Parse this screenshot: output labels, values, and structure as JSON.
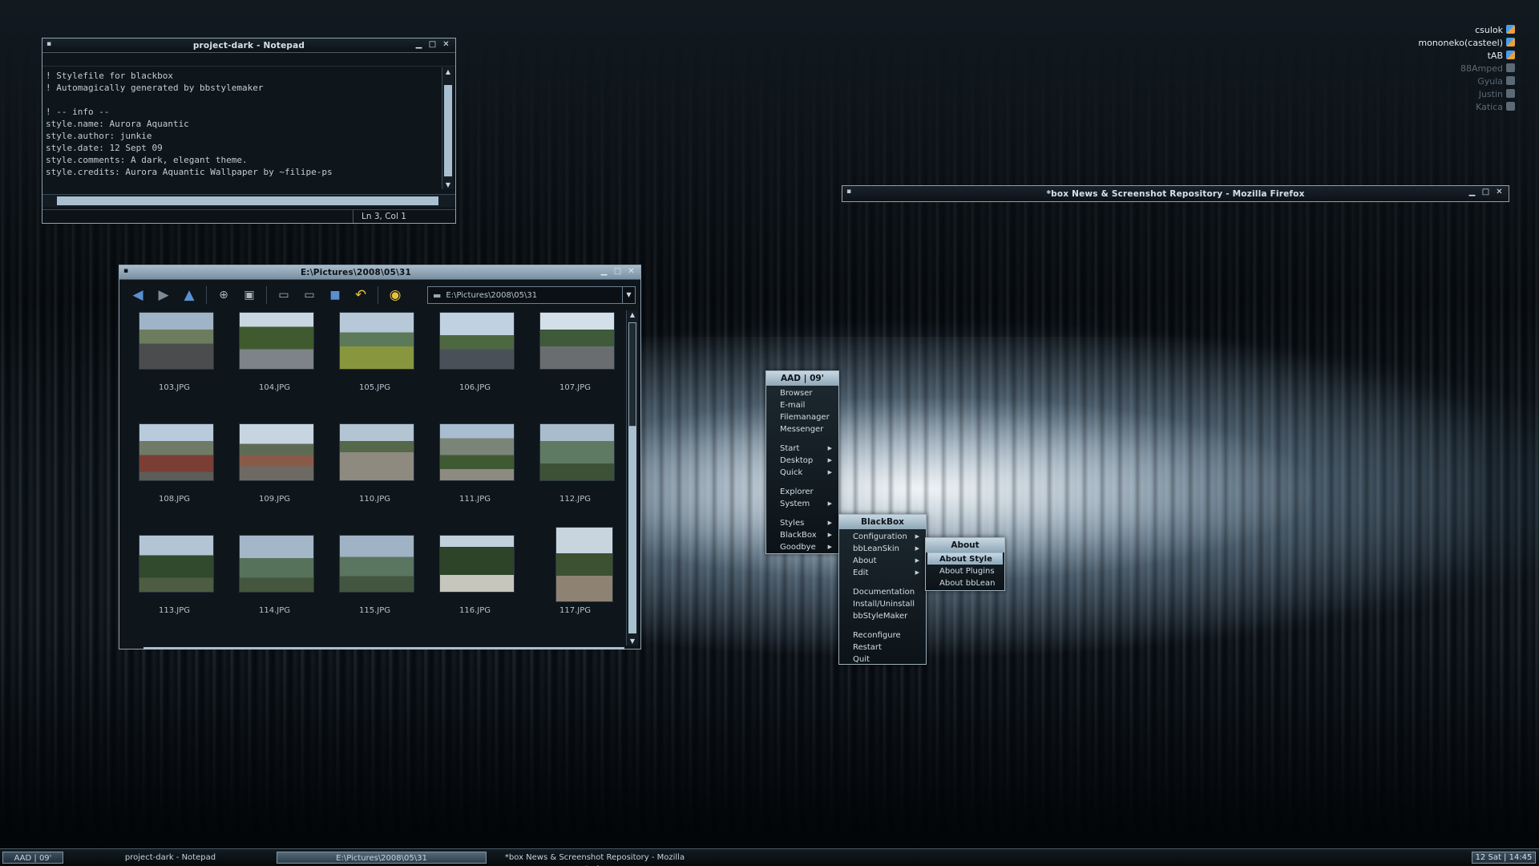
{
  "users": [
    {
      "name": "csulok",
      "online": true,
      "color": "#e8a040"
    },
    {
      "name": "mononeko(casteel)",
      "online": true,
      "color": "#e8a040"
    },
    {
      "name": "tAB",
      "online": true,
      "color": "#e8a040"
    },
    {
      "name": "88Amped",
      "online": false,
      "color": "#5b6a75"
    },
    {
      "name": "Gyula",
      "online": false,
      "color": "#5b6a75"
    },
    {
      "name": "Justin",
      "online": false,
      "color": "#5b6a75"
    },
    {
      "name": "Katica",
      "online": false,
      "color": "#5b6a75"
    }
  ],
  "notepad": {
    "title": "project-dark - Notepad",
    "lines": [
      "! Stylefile for blackbox",
      "! Automagically generated by bbstylemaker",
      "",
      "! -- info --",
      "style.name: Aurora Aquantic",
      "style.author: junkie",
      "style.date: 12 Sept 09",
      "style.comments: A dark, elegant theme.",
      "style.credits: Aurora Aquantic Wallpaper by ~filipe-ps"
    ],
    "status_position": "Ln 3, Col 1"
  },
  "firefox": {
    "title": "*box News & Screenshot Repository - Mozilla Firefox"
  },
  "explorer": {
    "title": "E:\\Pictures\\2008\\05\\31",
    "address": "E:\\Pictures\\2008\\05\\31",
    "files": [
      "103.JPG",
      "104.JPG",
      "105.JPG",
      "106.JPG",
      "107.JPG",
      "108.JPG",
      "109.JPG",
      "110.JPG",
      "111.JPG",
      "112.JPG",
      "113.JPG",
      "114.JPG",
      "115.JPG",
      "116.JPG",
      "117.JPG"
    ]
  },
  "main_menu": {
    "title": "AAD | 09'",
    "items": [
      {
        "label": "Browser",
        "submenu": false
      },
      {
        "label": "E-mail",
        "submenu": false
      },
      {
        "label": "Filemanager",
        "submenu": false
      },
      {
        "label": "Messenger",
        "submenu": false
      },
      {
        "label": "Start",
        "submenu": true
      },
      {
        "label": "Desktop",
        "submenu": true
      },
      {
        "label": "Quick",
        "submenu": true
      },
      {
        "label": "Explorer",
        "submenu": false
      },
      {
        "label": "System",
        "submenu": true
      },
      {
        "label": "Styles",
        "submenu": true
      },
      {
        "label": "BlackBox",
        "submenu": true
      },
      {
        "label": "Goodbye",
        "submenu": true
      }
    ]
  },
  "blackbox_menu": {
    "title": "BlackBox",
    "items": [
      {
        "label": "Configuration",
        "submenu": true
      },
      {
        "label": "bbLeanSkin",
        "submenu": true
      },
      {
        "label": "About",
        "submenu": true
      },
      {
        "label": "Edit",
        "submenu": true
      },
      {
        "label": "Documentation",
        "submenu": false
      },
      {
        "label": "Install/Uninstall",
        "submenu": false
      },
      {
        "label": "bbStyleMaker",
        "submenu": false
      },
      {
        "label": "Reconfigure",
        "submenu": false
      },
      {
        "label": "Restart",
        "submenu": false
      },
      {
        "label": "Quit",
        "submenu": false
      }
    ]
  },
  "about_menu": {
    "title": "About",
    "items": [
      {
        "label": "About Style",
        "highlighted": true
      },
      {
        "label": "About Plugins",
        "highlighted": false
      },
      {
        "label": "About bbLean",
        "highlighted": false
      }
    ]
  },
  "taskbar": {
    "start_label": "AAD | 09'",
    "tasks": [
      {
        "label": "project-dark - Notepad",
        "active": false
      },
      {
        "label": "E:\\Pictures\\2008\\05\\31",
        "active": true
      },
      {
        "label": "*box News & Screenshot Repository - Mozilla Firefox",
        "active": false
      }
    ],
    "clock": "12 Sat | 14:45"
  }
}
